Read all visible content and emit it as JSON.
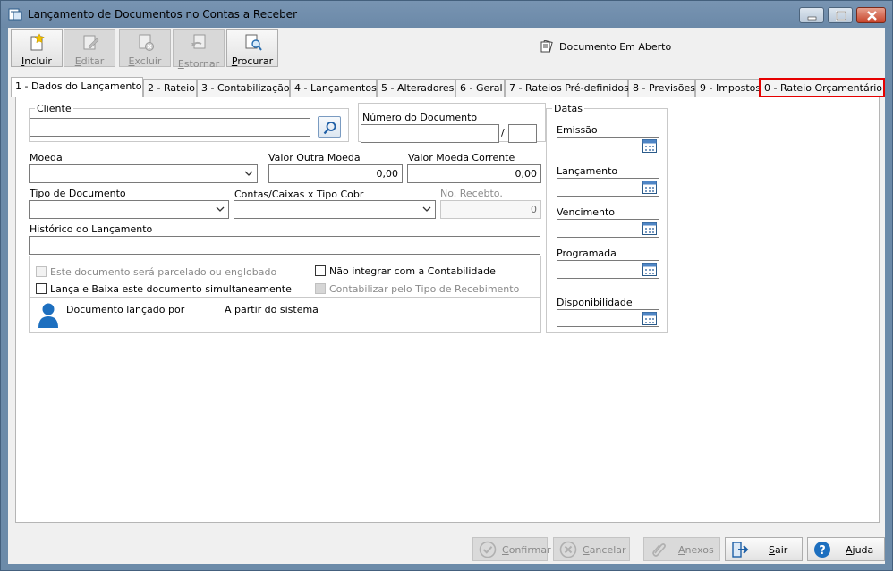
{
  "window": {
    "title": "Lançamento de Documentos no Contas a Receber"
  },
  "toolbar": {
    "incluir": "Incluir",
    "editar": "Editar",
    "excluir": "Excluir",
    "estornar": "Estornar",
    "procurar": "Procurar"
  },
  "status": "Documento Em Aberto",
  "tabs": [
    "1 - Dados do Lançamento",
    "2 - Rateio",
    "3 - Contabilização",
    "4 - Lançamentos",
    "5 - Alteradores",
    "6 - Geral",
    "7 - Rateios Pré-definidos",
    "8 - Previsões",
    "9 - Impostos",
    "0 - Rateio Orçamentário"
  ],
  "form": {
    "cliente_label": "Cliente",
    "cliente_value": "",
    "numero_documento_label": "Número do Documento",
    "numero_sep": "/",
    "moeda_label": "Moeda",
    "valor_outra_moeda_label": "Valor Outra Moeda",
    "valor_outra_moeda": "0,00",
    "valor_moeda_corrente_label": "Valor Moeda Corrente",
    "valor_moeda_corrente": "0,00",
    "tipo_documento_label": "Tipo de Documento",
    "contas_caixas_label": "Contas/Caixas x Tipo Cobr",
    "no_recebto_label": "No. Recebto.",
    "no_recebto": "0",
    "historico_label": "Histórico do Lançamento",
    "chk_parcelado": "Este documento será parcelado ou englobado",
    "chk_nao_integrar": "Não integrar com a Contabilidade",
    "chk_lanca_baixa": "Lança e Baixa este documento simultaneamente",
    "chk_contabilizar": "Contabilizar pelo Tipo de Recebimento",
    "lancado_por_label": "Documento lançado por",
    "origem": "A partir do sistema"
  },
  "datas": {
    "title": "Datas",
    "emissao": "Emissão",
    "lancamento": "Lançamento",
    "vencimento": "Vencimento",
    "programada": "Programada",
    "disponibilidade": "Disponibilidade"
  },
  "buttons": {
    "confirmar": "Confirmar",
    "cancelar": "Cancelar",
    "anexos": "Anexos",
    "sair": "Sair",
    "ajuda": "Ajuda"
  },
  "colors": {
    "highlight": "#e60000",
    "titlebar": "#6b89a8"
  }
}
